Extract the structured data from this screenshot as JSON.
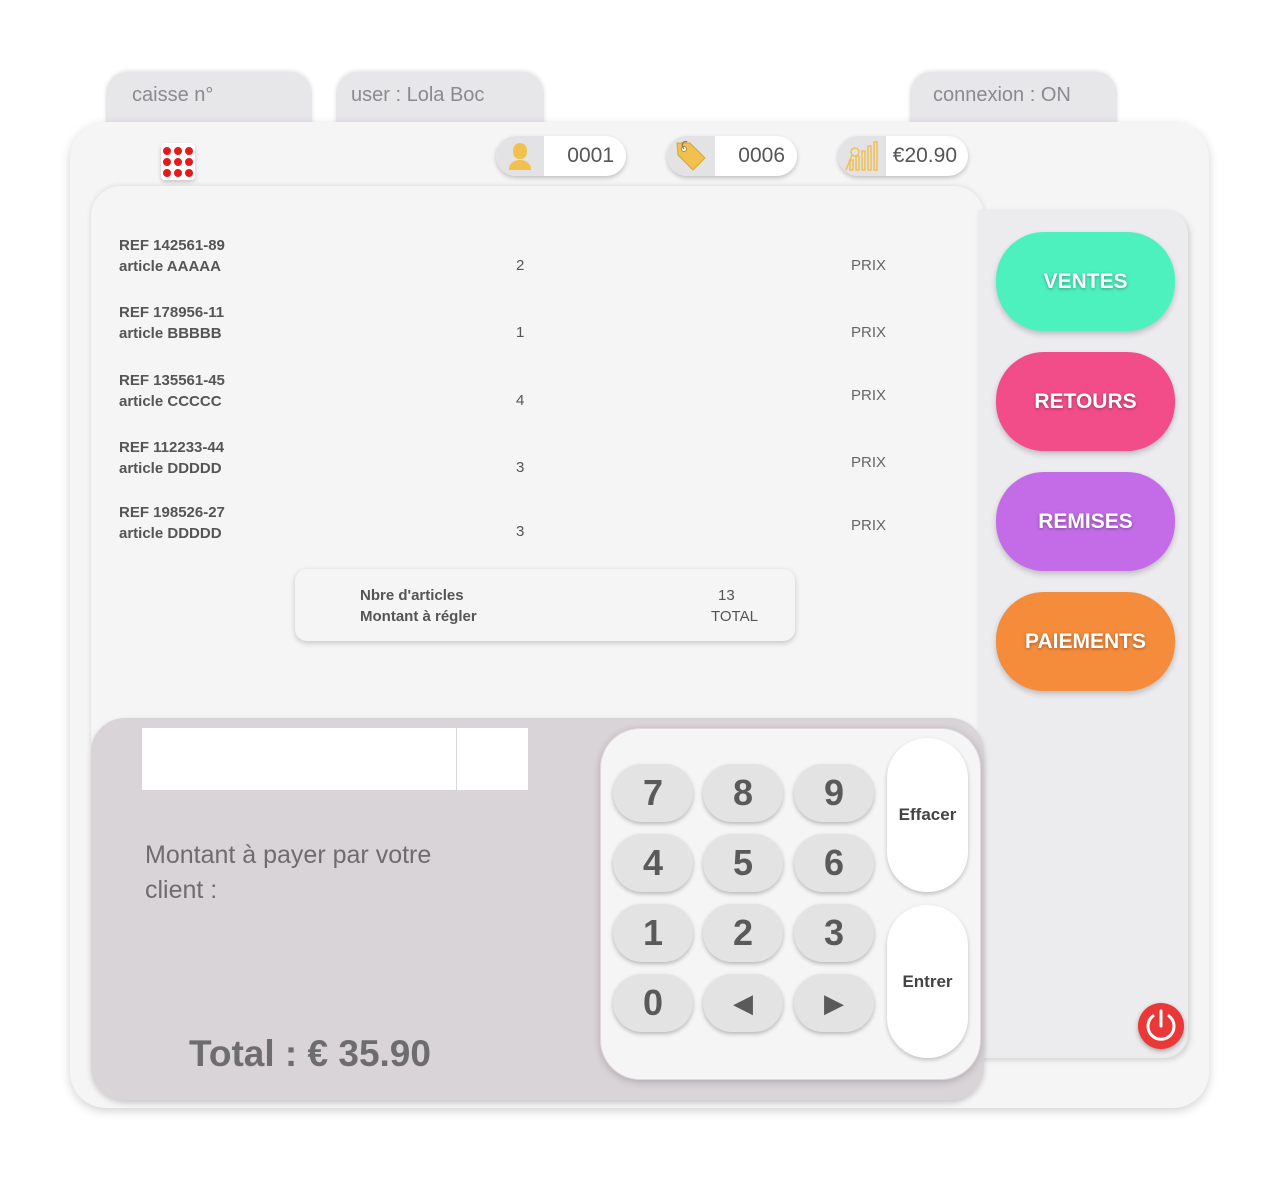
{
  "header": {
    "caisse_label": "caisse n°",
    "user_label": "user : Lola Boc",
    "connexion_label": "connexion : ON"
  },
  "toolbar": {
    "menu_icon": "grid-dots-icon",
    "clients_count": "0001",
    "articles_count": "0006",
    "sales_amount": "€20.90",
    "icons": [
      "user-bust-icon",
      "price-tag-icon",
      "bar-chart-icon"
    ],
    "accent_icon_color": "#f1c04f"
  },
  "articles": [
    {
      "ref": "REF 142561-89",
      "name": "article AAAAA",
      "qty": "2",
      "price": "PRIX"
    },
    {
      "ref": "REF 178956-11",
      "name": "article BBBBB",
      "qty": "1",
      "price": "PRIX"
    },
    {
      "ref": "REF 135561-45",
      "name": "article CCCCC",
      "qty": "4",
      "price": "PRIX"
    },
    {
      "ref": "REF 112233-44",
      "name": "article DDDDD",
      "qty": "3",
      "price": "PRIX"
    },
    {
      "ref": "REF 198526-27",
      "name": "article DDDDD",
      "qty": "3",
      "price": "PRIX"
    }
  ],
  "summary": {
    "count_label": "Nbre d'articles",
    "count_value": "13",
    "amount_label": "Montant à régler",
    "amount_value": "TOTAL"
  },
  "side_buttons": {
    "ventes": "VENTES",
    "retours": "RETOURS",
    "remises": "REMISES",
    "paiements": "PAIEMENTS",
    "colors": {
      "ventes": "#4cf1bd",
      "retours": "#f24d88",
      "remises": "#c46ce8",
      "paiements": "#f48c3c"
    }
  },
  "payment": {
    "prompt": "Montant à payer par votre client :",
    "total": "Total : € 35.90",
    "amount_value": "",
    "small_value": ""
  },
  "keypad": {
    "keys": [
      "7",
      "8",
      "9",
      "4",
      "5",
      "6",
      "1",
      "2",
      "3",
      "0",
      "◀",
      "▶"
    ],
    "effacer": "Effacer",
    "entrer": "Entrer"
  },
  "power_icon": "power-icon",
  "power_color": "#ea3838"
}
